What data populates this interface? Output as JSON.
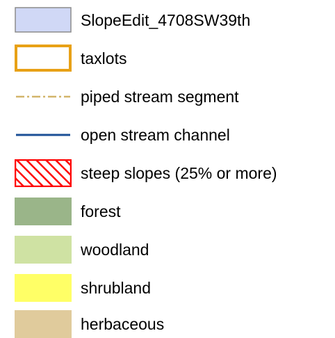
{
  "legend": {
    "items": [
      {
        "label": "SlopeEdit_4708SW39th",
        "symbol": "fill-outline",
        "fill": "#d0d8f6",
        "stroke": "#8c8c8c"
      },
      {
        "label": "taxlots",
        "symbol": "outline",
        "stroke": "#e8a116"
      },
      {
        "label": "piped stream segment",
        "symbol": "dash-dot-line",
        "stroke": "#d2b56a"
      },
      {
        "label": "open stream channel",
        "symbol": "line",
        "stroke": "#1b4f96"
      },
      {
        "label": "steep slopes (25% or more)",
        "symbol": "hatch",
        "stroke": "#ff0000"
      },
      {
        "label": "forest",
        "symbol": "fill",
        "fill": "#9ab589"
      },
      {
        "label": "woodland",
        "symbol": "fill",
        "fill": "#cfe2a3"
      },
      {
        "label": "shrubland",
        "symbol": "fill",
        "fill": "#ffff66"
      },
      {
        "label": "herbaceous",
        "symbol": "fill",
        "fill": "#e0cb9c"
      }
    ]
  }
}
